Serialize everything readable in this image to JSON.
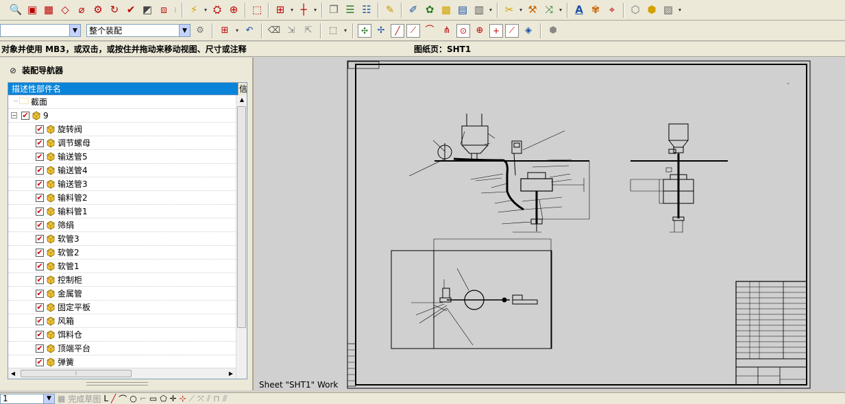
{
  "toolbar_top": {
    "icons": [
      "find-icon",
      "part-view-icon",
      "layout-icon",
      "eraser-icon",
      "measure-icon",
      "gear-icon",
      "rotate-icon",
      "check-icon",
      "display-icon",
      "section-icon",
      "update-icon",
      "orient-icon",
      "zoom-icon",
      "fit-icon",
      "views-icon",
      "grid-icon",
      "copy-icon",
      "layers-icon",
      "layers-alt-icon",
      "pencil-icon",
      "paint-icon",
      "color-icon",
      "cube-icon",
      "table-icon",
      "edit-icon",
      "hammer-icon",
      "arrow-icon",
      "text-style-icon",
      "spell-icon",
      "move-icon",
      "shape-icon",
      "cube-yellow-icon",
      "hatch-icon"
    ]
  },
  "toolbar_filter": {
    "filter_value": "",
    "scope_value": "整个装配"
  },
  "cue_line": {
    "prompt": "对象并使用 MB3，或双击，或按住并拖动来移动视图、尺寸或注释",
    "sheet_status": "图纸页：SHT1"
  },
  "navigator": {
    "title": "装配导航器",
    "column_header": "描述性部件名",
    "column_header_2": "信",
    "section_item": "截面",
    "root_item": "9",
    "parts": [
      "旋转阀",
      "调节螺母",
      "输送管5",
      "输送管4",
      "输送管3",
      "输料管2",
      "输料管1",
      "筛绢",
      "软管3",
      "软管2",
      "软管1",
      "控制柜",
      "金属管",
      "固定平板",
      "风箱",
      "饵料仓",
      "顶端平台",
      "弹簧"
    ]
  },
  "graphics": {
    "sheet_label": "Sheet \"SHT1\" Work"
  },
  "bottom_bar": {
    "combo_value": "1",
    "finish_sketch": "完成草图"
  },
  "colors": {
    "toolbar_bg": "#ece9d8",
    "header_blue": "#0a84d8",
    "check_red": "#d00000",
    "canvas_grey": "#d0d0d0"
  }
}
